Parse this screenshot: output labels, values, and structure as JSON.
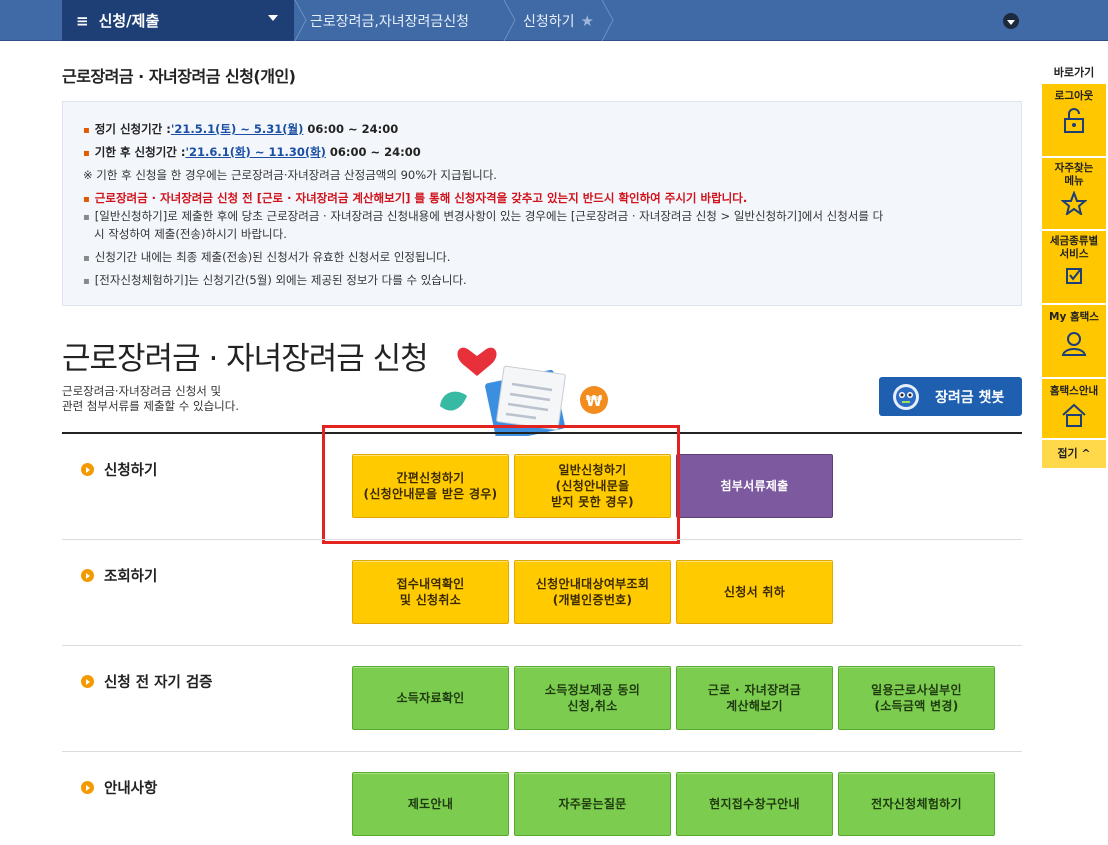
{
  "topbar": {
    "menu_label": "신청/제출",
    "menu_icon": "hamburger-icon",
    "crumb1": "근로장려금,자녀장려금신청",
    "crumb2": "신청하기"
  },
  "page_title": "근로장려금 · 자녀장려금 신청(개인)",
  "info": {
    "l1_label": "정기 신청기간 :",
    "l1_link": "'21.5.1(토) ~ 5.31(월)",
    "l1_time": " 06:00 ~ 24:00",
    "l2_label": "기한 후 신청기간 :",
    "l2_link": "'21.6.1(화) ~ 11.30(화)",
    "l2_time": " 06:00 ~ 24:00",
    "l3": "※ 기한 후 신청을 한 경우에는 근로장려금·자녀장려금 산정금액의 90%가 지급됩니다.",
    "l4": "근로장려금 · 자녀장려금 신청 전 [근로 · 자녀장려금 계산해보기] 를 통해 신청자격을 갖추고 있는지 반드시 확인하여 주시기 바랍니다.",
    "l5a": "[일반신청하기]로 제출한 후에 당초 근로장려금 · 자녀장려금 신청내용에 변경사항이 있는 경우에는  [근로장려금 · 자녀장려금 신청 > 일반신청하기]에서  신청서를 다",
    "l5b": "시 작성하여 제출(전송)하시기 바랍니다.",
    "l6": "신청기간 내에는 최종 제출(전송)된 신청서가 유효한 신청서로 인정됩니다.",
    "l7": "[전자신청체험하기]는 신청기간(5월) 외에는 제공된 정보가 다를 수 있습니다."
  },
  "heading": "근로장려금 · 자녀장려금 신청",
  "desc_line1": "근로장려금·자녀장려금 신청서 및",
  "desc_line2": "관련 첨부서류를 제출할 수 있습니다.",
  "chatbot_label": "장려금 챗봇",
  "sections": {
    "apply": {
      "label": "신청하기",
      "b1": "간편신청하기\n(신청안내문을 받은 경우)",
      "b2": "일반신청하기\n(신청안내문을\n받지 못한 경우)",
      "b3": "첨부서류제출"
    },
    "inquiry": {
      "label": "조회하기",
      "b1": "접수내역확인\n및 신청취소",
      "b2": "신청안내대상여부조회\n(개별인증번호)",
      "b3": "신청서 취하"
    },
    "verify": {
      "label": "신청 전 자기 검증",
      "b1": "소득자료확인",
      "b2": "소득정보제공 동의\n신청,취소",
      "b3": "근로 · 자녀장려금\n계산해보기",
      "b4": "일용근로사실부인\n(소득금액 변경)"
    },
    "guide": {
      "label": "안내사항",
      "b1": "제도안내",
      "b2": "자주묻는질문",
      "b3": "현지접수창구안내",
      "b4": "전자신청체험하기"
    }
  },
  "quick": {
    "title": "바로가기",
    "i1": "로그아웃",
    "i2": "자주찾는\n메뉴",
    "i3": "세금종류별\n서비스",
    "i4": "My 홈택스",
    "i5": "홈택스안내",
    "fold": "접기"
  },
  "colors": {
    "nav_dark": "#1d3f75",
    "nav": "#3f6aa5",
    "yellow": "#ffcb00",
    "purple": "#7d5aa0",
    "green": "#7ccd4f",
    "highlight": "#e3231f"
  }
}
